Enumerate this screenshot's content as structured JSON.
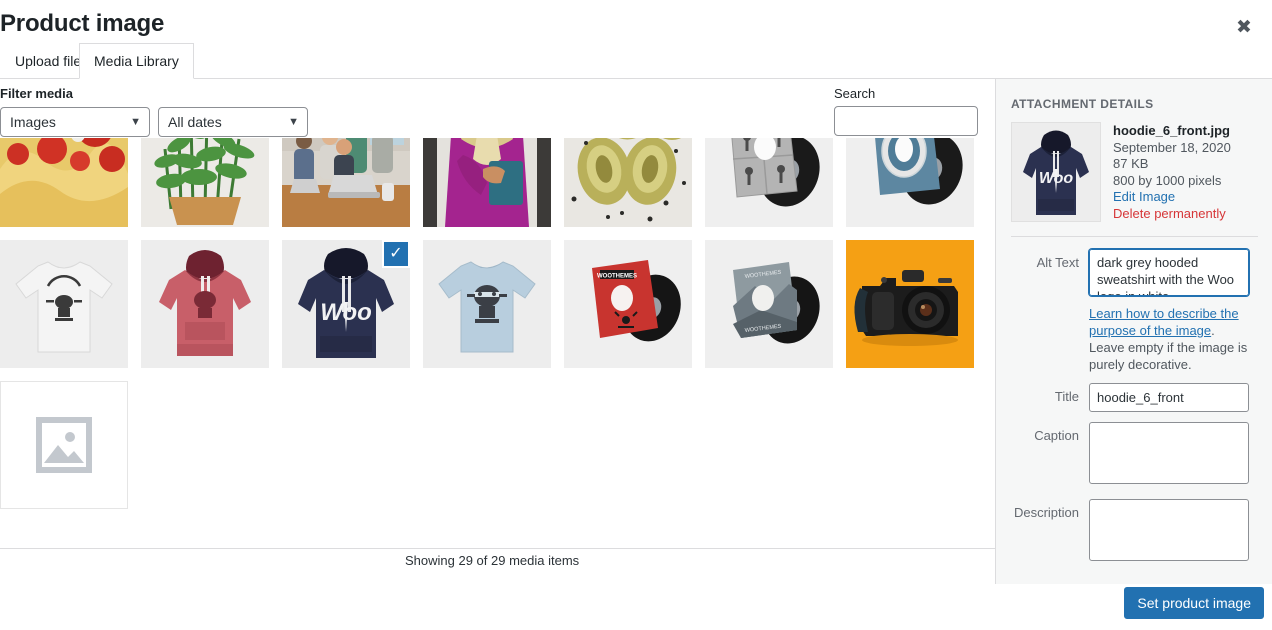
{
  "modal": {
    "title": "Product image",
    "close_icon": "close-icon"
  },
  "tabs": [
    {
      "label": "Upload files",
      "active": false
    },
    {
      "label": "Media Library",
      "active": true
    }
  ],
  "toolbar": {
    "filter_label": "Filter media",
    "type_filter": "Images",
    "date_filter": "All dates",
    "search_label": "Search",
    "search_value": "",
    "search_placeholder": ""
  },
  "grid": {
    "items": [
      {
        "name": "pasta-tomatoes",
        "selected": false
      },
      {
        "name": "rosemary-plant",
        "selected": false
      },
      {
        "name": "office-meeting",
        "selected": false
      },
      {
        "name": "woman-purple-dress",
        "selected": false
      },
      {
        "name": "artichokes",
        "selected": false
      },
      {
        "name": "vinyl-grey-keys",
        "selected": false
      },
      {
        "name": "vinyl-blue-circle",
        "selected": false
      },
      {
        "name": "tshirt-white",
        "selected": false
      },
      {
        "name": "hoodie-red",
        "selected": false
      },
      {
        "name": "hoodie-navy-woo",
        "selected": true
      },
      {
        "name": "tshirt-blue-ninja",
        "selected": false
      },
      {
        "name": "vinyl-red-cover",
        "selected": false
      },
      {
        "name": "vinyl-landscape-cover",
        "selected": false
      },
      {
        "name": "dslr-camera-orange",
        "selected": false
      },
      {
        "name": "image-placeholder",
        "selected": false
      }
    ],
    "selected_check_icon": "checkmark-icon",
    "placeholder_icon": "image-placeholder-icon",
    "status_text": "Showing 29 of 29 media items"
  },
  "attachment": {
    "heading": "ATTACHMENT DETAILS",
    "filename": "hoodie_6_front.jpg",
    "date": "September 18, 2020",
    "filesize": "87 KB",
    "dimensions": "800 by 1000 pixels",
    "edit_link": "Edit Image",
    "delete_link": "Delete permanently",
    "fields": {
      "alt_text_label": "Alt Text",
      "alt_text_value": "dark grey hooded sweatshirt with the Woo logo in white",
      "alt_help_link": "Learn how to describe the purpose of the image",
      "alt_help_rest": ". Leave empty if the image is purely decorative.",
      "title_label": "Title",
      "title_value": "hoodie_6_front",
      "caption_label": "Caption",
      "caption_value": "",
      "description_label": "Description",
      "description_value": ""
    }
  },
  "footer": {
    "primary_button": "Set product image"
  },
  "colors": {
    "accent": "#2271b1",
    "danger": "#d63638",
    "sidebar_bg": "#f6f7f7",
    "border": "#dcdcde"
  }
}
